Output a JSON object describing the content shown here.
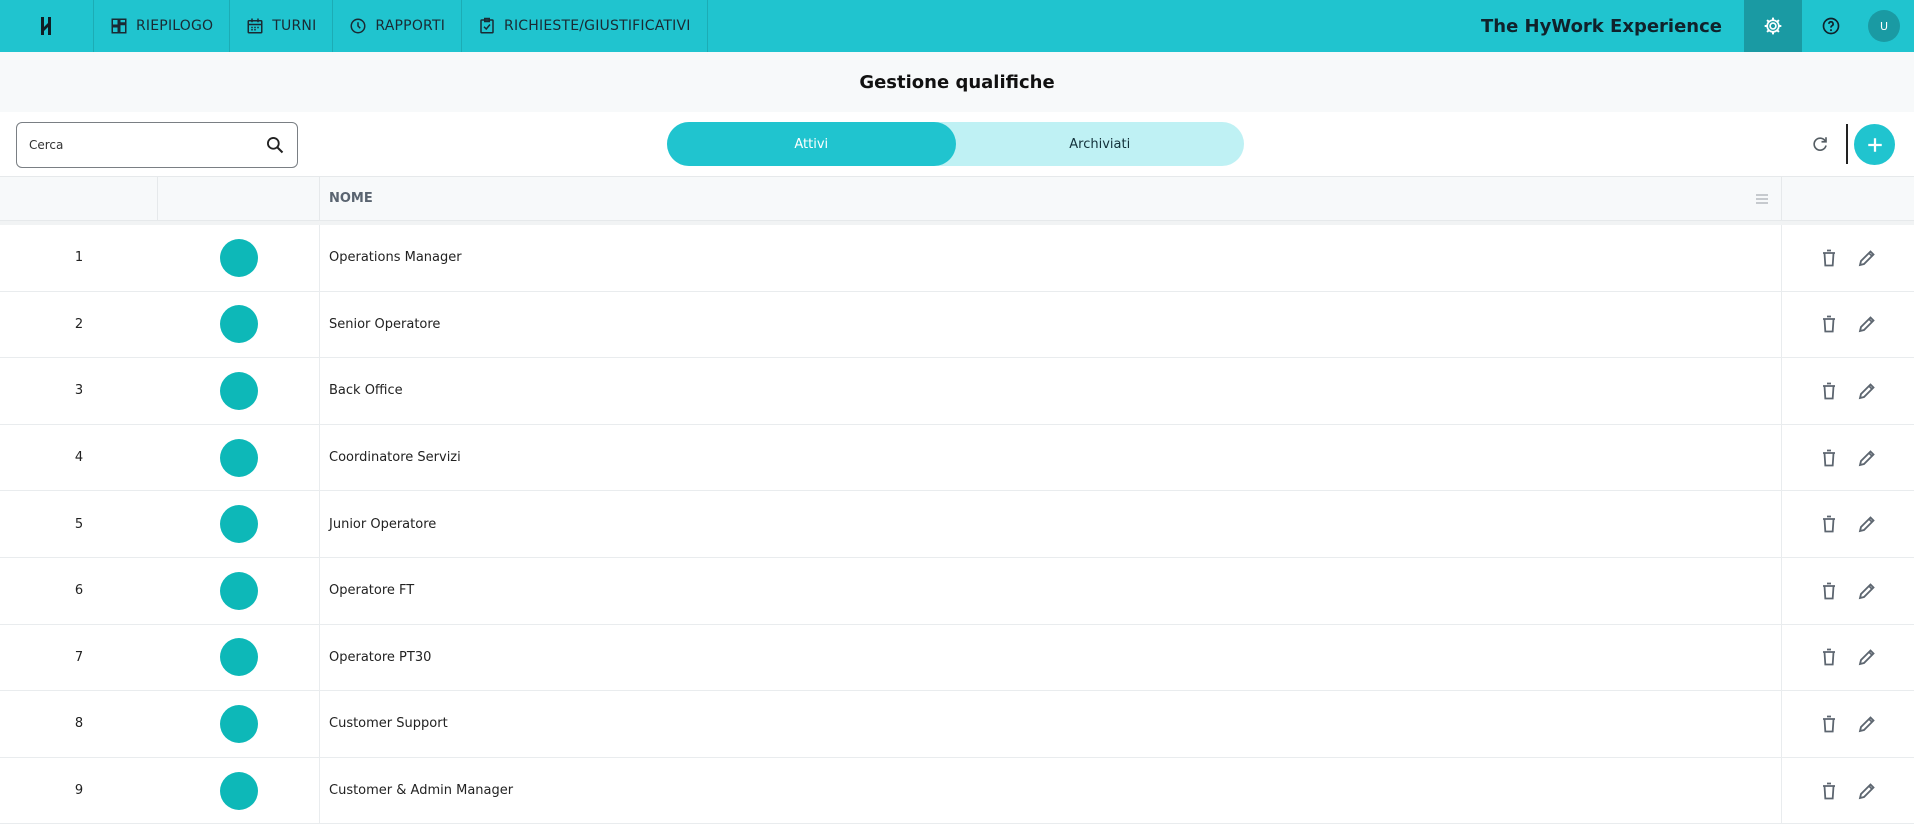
{
  "nav": {
    "items": [
      {
        "label": "RIEPILOGO",
        "icon": "dashboard-icon"
      },
      {
        "label": "TURNI",
        "icon": "calendar-icon"
      },
      {
        "label": "RAPPORTI",
        "icon": "clock-icon"
      },
      {
        "label": "RICHIESTE/GIUSTIFICATIVI",
        "icon": "checklist-icon"
      }
    ],
    "app_title": "The HyWork Experience",
    "avatar_initial": "U"
  },
  "page": {
    "title": "Gestione qualifiche"
  },
  "toolbar": {
    "search_placeholder": "Cerca",
    "tabs": [
      {
        "label": "Attivi",
        "active": true
      },
      {
        "label": "Archiviati",
        "active": false
      }
    ]
  },
  "table": {
    "headers": {
      "name": "NOME"
    },
    "rows": [
      {
        "index": "1",
        "name": "Operations Manager",
        "color": "#0db8b8"
      },
      {
        "index": "2",
        "name": "Senior Operatore",
        "color": "#0db8b8"
      },
      {
        "index": "3",
        "name": "Back Office",
        "color": "#0db8b8"
      },
      {
        "index": "4",
        "name": "Coordinatore Servizi",
        "color": "#0db8b8"
      },
      {
        "index": "5",
        "name": "Junior Operatore",
        "color": "#0db8b8"
      },
      {
        "index": "6",
        "name": "Operatore FT",
        "color": "#0db8b8"
      },
      {
        "index": "7",
        "name": "Operatore PT30",
        "color": "#0db8b8"
      },
      {
        "index": "8",
        "name": "Customer Support",
        "color": "#0db8b8"
      },
      {
        "index": "9",
        "name": "Customer & Admin Manager",
        "color": "#0db8b8"
      }
    ]
  },
  "colors": {
    "accent": "#20c4cf",
    "accent_dark": "#1a9aa3",
    "tab_inactive": "#bff1f4"
  }
}
